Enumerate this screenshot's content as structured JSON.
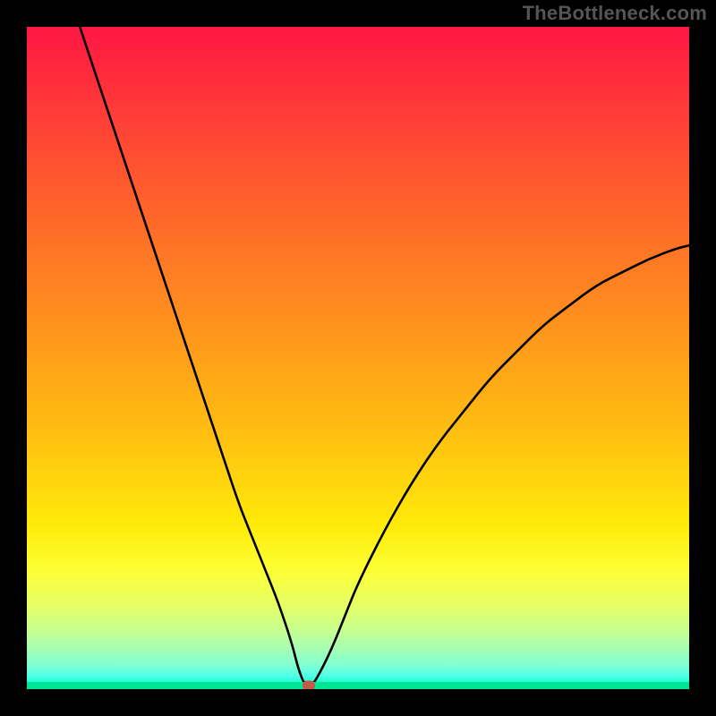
{
  "watermark": "TheBottleneck.com",
  "colors": {
    "frame_border": "#000000",
    "gradient_top": "#ff1744",
    "gradient_mid": "#ffd30d",
    "gradient_bottom": "#00ffa6",
    "curve_stroke": "#000000",
    "baseline": "#00e593",
    "marker": "#c25a4a"
  },
  "chart_data": {
    "type": "line",
    "title": "",
    "xlabel": "",
    "ylabel": "",
    "xlim": [
      0,
      100
    ],
    "ylim": [
      0,
      100
    ],
    "grid": false,
    "notes": "V-shaped bottleneck curve over vertical red→yellow→green gradient. y=100 maps to top (red), y=0 maps to bottom (green). Minimum sits on the green baseline near x≈42, marked with a small rounded rectangle.",
    "series": [
      {
        "name": "bottleneck-curve",
        "x": [
          8,
          10,
          12,
          14,
          16,
          18,
          20,
          22,
          24,
          26,
          28,
          30,
          32,
          34,
          36,
          38,
          40,
          41,
          42,
          43,
          44,
          46,
          48,
          50,
          54,
          58,
          62,
          66,
          70,
          74,
          78,
          82,
          86,
          90,
          94,
          98,
          100
        ],
        "y": [
          100,
          94,
          88,
          82,
          76,
          70,
          64,
          58,
          52,
          46,
          40,
          34,
          28,
          23,
          18,
          13,
          7,
          3,
          0.5,
          0.5,
          2,
          6,
          11,
          16,
          24,
          31,
          37,
          42,
          47,
          51,
          55,
          58,
          61,
          63,
          65,
          66.5,
          67
        ]
      }
    ],
    "marker": {
      "x": 42.5,
      "y": 0.6
    },
    "baseline_y": 0
  }
}
